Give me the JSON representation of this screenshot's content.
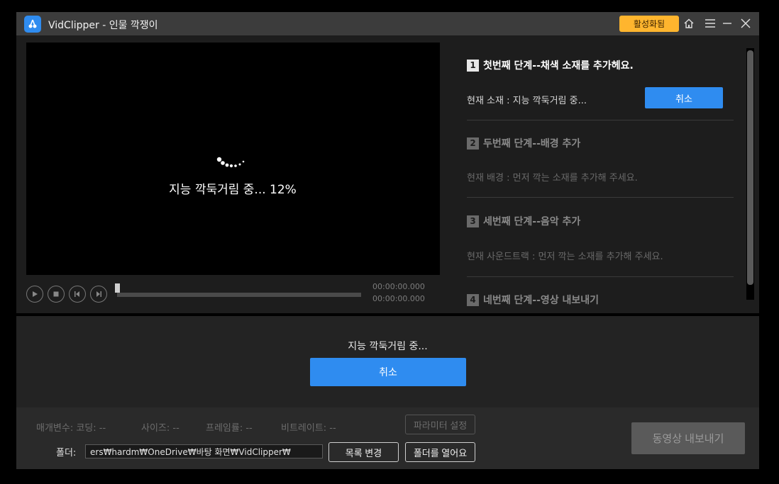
{
  "window": {
    "title": "VidClipper - 인물 깍쟁이",
    "activate_label": "활성화됨",
    "icons": [
      "home-icon",
      "menu-icon",
      "minimize-icon",
      "close-icon"
    ]
  },
  "preview": {
    "progress_text": "지능 깍둑거림 중... 12%",
    "progress_percent": 12,
    "time_current": "00:00:00.000",
    "time_total": "00:00:00.000",
    "controls": [
      "play-icon",
      "stop-icon",
      "prev-frame-icon",
      "next-frame-icon"
    ]
  },
  "steps": [
    {
      "num": "1",
      "title": "첫번째 단계--채색 소재를 추가헤요.",
      "desc": "현재 소재 : 지능 깍둑거림 중...",
      "active": true,
      "button": "취소"
    },
    {
      "num": "2",
      "title": "두번째 단계--배경 추가",
      "desc": "현재 배경 : 먼저 깍는 소재를 추가해 주세요.",
      "active": false
    },
    {
      "num": "3",
      "title": "세번째 단계--음악 추가",
      "desc": "현재 사운드트랙 : 먼저 깍는 소재를 추가해 주세요.",
      "active": false
    },
    {
      "num": "4",
      "title": "네번째 단계--영상 내보내기",
      "active": false
    }
  ],
  "middle": {
    "status": "지능 깍둑거림 중...",
    "cancel_label": "취소"
  },
  "bottom": {
    "params": [
      "매개변수: 코딩: --",
      "사이즈: --",
      "프레임률: --",
      "비트레이트: --"
    ],
    "param_settings_label": "파라미터 설정",
    "folder_label": "폴더:",
    "folder_path": "ers₩hardm₩OneDrive₩바탕 화면₩VidClipper₩",
    "change_dir_label": "목록 변경",
    "open_folder_label": "폴더를 열어요",
    "export_label": "동영상 내보내기"
  },
  "colors": {
    "accent": "#2f8cf0",
    "activate": "#ffb52e",
    "background": "#1d1d1d"
  }
}
